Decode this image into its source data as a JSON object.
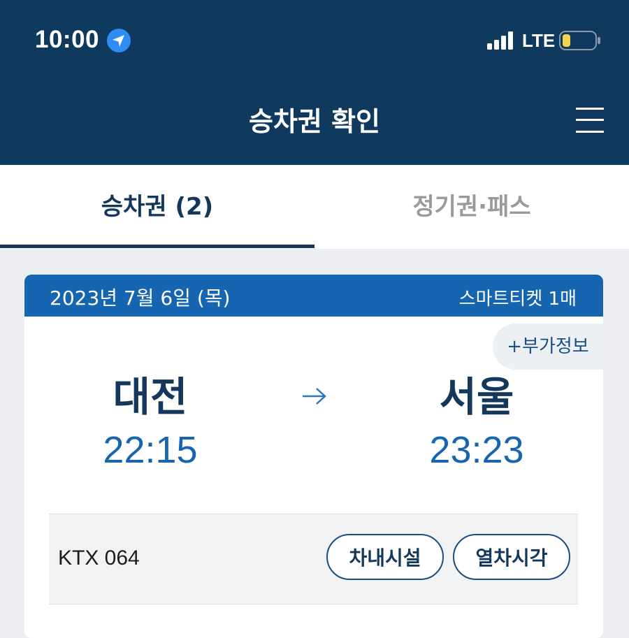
{
  "status_bar": {
    "time": "10:00",
    "network": "LTE",
    "icons": [
      "location-arrow-icon",
      "signal-icon",
      "battery-icon"
    ],
    "battery_level": 0.25
  },
  "header": {
    "title": "승차권 확인",
    "menu_icon": "menu-icon"
  },
  "tabs": [
    {
      "label": "승차권 (2)",
      "active": true
    },
    {
      "label": "정기권·패스",
      "active": false
    }
  ],
  "ticket": {
    "date": "2023년 7월 6일 (목)",
    "ticket_type": "스마트티켓 1매",
    "extra_info_label": "+부가정보",
    "departure": {
      "station": "대전",
      "time": "22:15"
    },
    "arrival": {
      "station": "서울",
      "time": "23:23"
    },
    "train_number": "KTX 064",
    "buttons": {
      "facilities": "차내시설",
      "timetable": "열차시각"
    }
  },
  "colors": {
    "header_bg": "#0f3a5e",
    "ticket_header_bg": "#1565b1",
    "time_blue": "#1765b0",
    "station_navy": "#13385c",
    "battery_yellow": "#f7d54a"
  }
}
